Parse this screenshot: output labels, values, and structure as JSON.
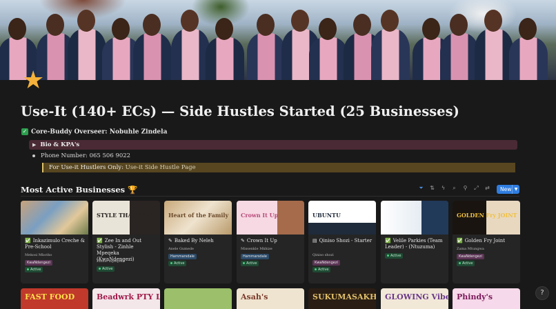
{
  "page": {
    "title": "Use-It (140+ ECs) — Side Hustles Started (25 Businesses)",
    "icon": "star-icon"
  },
  "overseer": {
    "label": "Core-Buddy Overseer: Nobuhle Zindela"
  },
  "bio_toggle": {
    "label": "Bio & KPA's"
  },
  "phone": {
    "label": "Phone Number: 065 506 9022"
  },
  "callout": {
    "prefix": "For Use-it Hustlers Only:",
    "link": "Use-it Side Hustle Page"
  },
  "section": {
    "title": "Most Active Businesses",
    "emoji": "🏆",
    "new_label": "New"
  },
  "colors": {
    "accent": "#2f7de0",
    "toggle_bg": "#4a2a34",
    "callout_bg": "#574620",
    "active_green": "#4bd083"
  },
  "cards": [
    {
      "name": "Inkazimulo Creche & Pre-School",
      "owner": "Mekosi Mbotho",
      "tag": "KwaNdengezi",
      "status": "Active",
      "icon": "check-icon"
    },
    {
      "name": "Zee In and Out Stylish - Zinhle Mpeqeka (KwaNdengezi)",
      "owner": "Zinhle mpeqeka",
      "tag": "",
      "status": "Active",
      "icon": "check-icon"
    },
    {
      "name": "Baked By Neleh",
      "owner": "Anele Gumede",
      "tag": "Hammarsdale",
      "status": "Active",
      "icon": "pin-icon"
    },
    {
      "name": "Crown It Up",
      "owner": "Missenkle Mkhize",
      "tag": "Hammarsdale",
      "status": "Active",
      "icon": "pin-icon"
    },
    {
      "name": "Qiniso Shozi - Starter",
      "owner": "Qiniso shozi",
      "tag": "KwaNdengezi",
      "status": "Active",
      "icon": "document-icon"
    },
    {
      "name": "Velile Parkies (Team Leader) - (Ntuzuma)",
      "owner": "",
      "tag": "",
      "status": "Active",
      "icon": "check-icon"
    },
    {
      "name": "Golden Fry Joint",
      "owner": "Zama Mtungwa",
      "tag": "KwaNdengezi",
      "status": "Active",
      "icon": "check-icon"
    }
  ],
  "card_images": [
    {
      "text": ""
    },
    {
      "text": "STYLE THAT SPEAKS"
    },
    {
      "text": "Heart of the Family"
    },
    {
      "text": "Crown It Up"
    },
    {
      "text": "UBUNTU"
    },
    {
      "text": ""
    },
    {
      "text": "GOLDEN Fry JOINT"
    }
  ],
  "row2_images": [
    {
      "text": "FAST FOOD"
    },
    {
      "text": "Beadwrk PTY LTD"
    },
    {
      "text": ""
    },
    {
      "text": "Asah's"
    },
    {
      "text": "SUKUMASAKHE"
    },
    {
      "text": "GLOWING Vibes"
    },
    {
      "text": "Phindy's"
    }
  ]
}
